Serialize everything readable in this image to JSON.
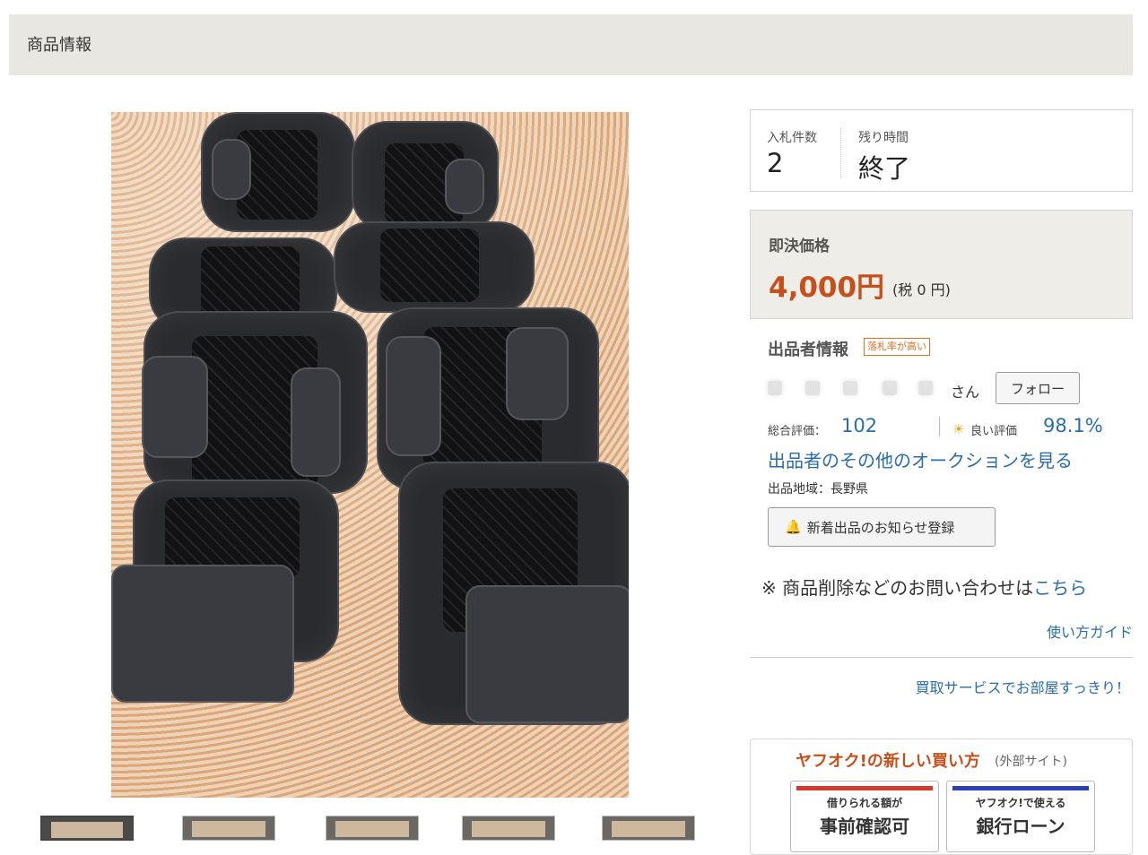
{
  "section": {
    "title": "商品情報"
  },
  "bids": {
    "count_label": "入札件数",
    "count_value": "2",
    "time_label": "残り時間",
    "time_value": "終了"
  },
  "price": {
    "label": "即決価格",
    "value": "4,000円",
    "tax": "(税 0 円)",
    "color": "#c5501b"
  },
  "seller": {
    "title": "出品者情報",
    "badge": "落札率が高い",
    "san": "さん",
    "follow_label": "フォロー",
    "rating_label": "総合評価：",
    "rating_value": "102",
    "good_label": "良い評価",
    "good_value": "98.1%",
    "other_auctions_link": "出品者のその他のオークションを見る",
    "region": "出品地域：長野県",
    "notify_label": "新着出品のお知らせ登録",
    "notify_icon": "bell-icon",
    "good_icon": "sun-icon"
  },
  "inquiry": {
    "text": "※ 商品削除などのお問い合わせは",
    "link": "こちら"
  },
  "links": {
    "guide": "使い方ガイド",
    "kaitori": "買取サービスでお部屋すっきり！"
  },
  "new_buy": {
    "title": "ヤフオク!の新しい買い方",
    "external": "(外部サイト)",
    "cards": [
      {
        "small": "借りられる額が",
        "big": "事前確認可",
        "bar_color": "#d33a2c"
      },
      {
        "small": "ヤフオク!で使える",
        "big": "銀行ローン",
        "bar_color": "#2a3fb8"
      }
    ]
  },
  "thumbnails": {
    "count": 5,
    "selected": 1
  },
  "colors": {
    "link": "#2a6ea8",
    "accent": "#c5501b",
    "header_bg": "#e8e7e2"
  }
}
